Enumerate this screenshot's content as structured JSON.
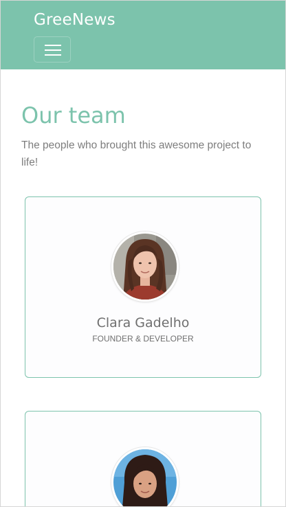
{
  "navbar": {
    "brand": "GreeNews",
    "menu_icon": "hamburger-menu-icon",
    "background": "#7cc3ac"
  },
  "team": {
    "heading": "Our team",
    "subtitle": "The people who brought this awesome project to life!",
    "members": [
      {
        "name": "Clara Gadelho",
        "role": "FOUNDER & DEVELOPER"
      },
      {
        "name": "",
        "role": ""
      }
    ]
  },
  "colors": {
    "accent": "#7cc3ac",
    "text_muted": "#7d7d7d"
  }
}
